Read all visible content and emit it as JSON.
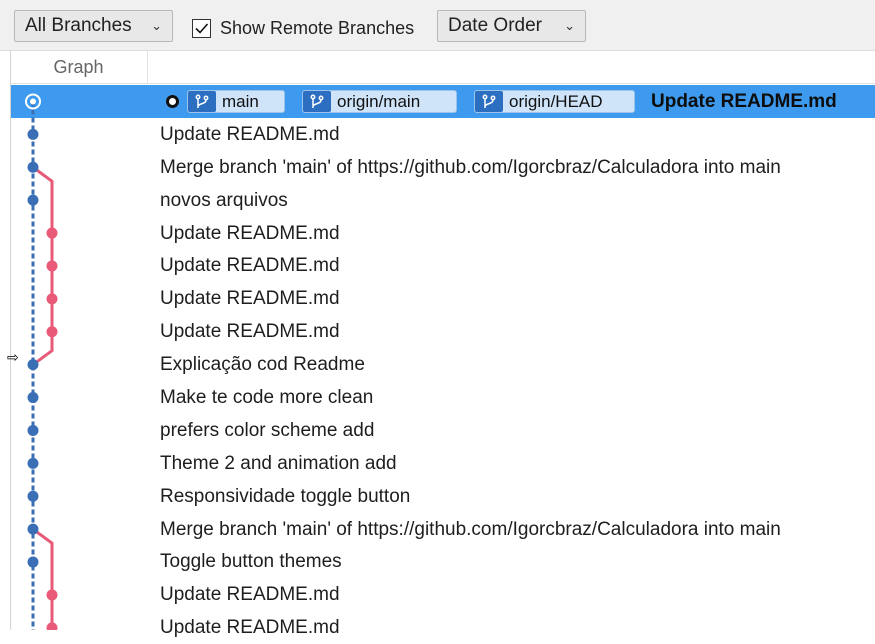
{
  "toolbar": {
    "branch_filter": "All Branches",
    "show_remote_label": "Show Remote Branches",
    "show_remote_checked": true,
    "order": "Date Order"
  },
  "columns": {
    "graph": "Graph"
  },
  "refs": {
    "local": "main",
    "remote_main": "origin/main",
    "remote_head": "origin/HEAD"
  },
  "commits": [
    {
      "message": "Update README.md",
      "lane": "blue",
      "selected": true
    },
    {
      "message": "Update README.md",
      "lane": "blue"
    },
    {
      "message": "Merge branch 'main' of https://github.com/Igorcbraz/Calculadora into main",
      "lane": "blue"
    },
    {
      "message": "novos arquivos",
      "lane": "blue"
    },
    {
      "message": "Update README.md",
      "lane": "red"
    },
    {
      "message": "Update README.md",
      "lane": "red"
    },
    {
      "message": "Update README.md",
      "lane": "red"
    },
    {
      "message": "Update README.md",
      "lane": "red"
    },
    {
      "message": "Explicação cod Readme",
      "lane": "blue"
    },
    {
      "message": "Make te code more clean",
      "lane": "blue"
    },
    {
      "message": "prefers color scheme add",
      "lane": "blue"
    },
    {
      "message": "Theme 2 and animation add",
      "lane": "blue"
    },
    {
      "message": "Responsividade toggle button",
      "lane": "blue"
    },
    {
      "message": "Merge branch 'main' of https://github.com/Igorcbraz/Calculadora into main",
      "lane": "blue"
    },
    {
      "message": "Toggle button themes",
      "lane": "blue"
    },
    {
      "message": "Update README.md",
      "lane": "red"
    },
    {
      "message": "Update README.md",
      "lane": "red"
    }
  ],
  "colors": {
    "selection": "#3d9aee",
    "lane_blue": "#3a6fb5",
    "lane_red": "#e85a78",
    "tag_badge": "#2c6fc1"
  }
}
